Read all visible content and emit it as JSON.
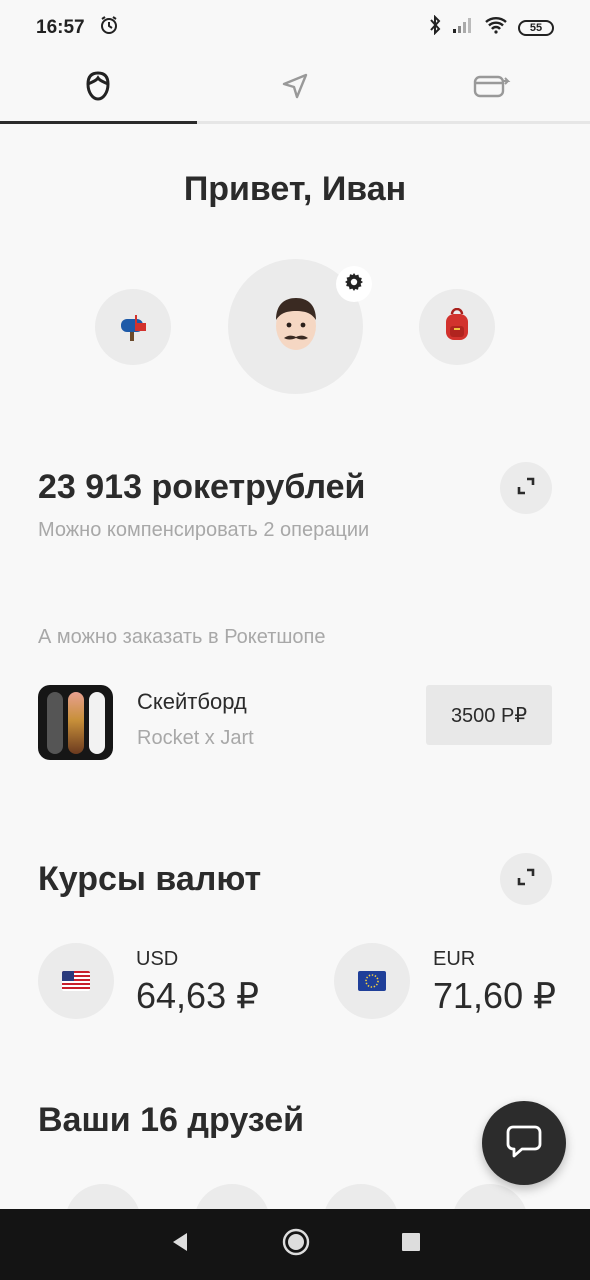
{
  "status_bar": {
    "time": "16:57",
    "battery": "55"
  },
  "tabs": [
    {
      "name": "profile",
      "icon": "face-icon",
      "active": true
    },
    {
      "name": "send",
      "icon": "paper-plane-icon",
      "active": false
    },
    {
      "name": "cards",
      "icon": "card-icon",
      "active": false
    }
  ],
  "greeting": "Привет, Иван",
  "avatars": {
    "left_emoji": "📫",
    "main_emoji": "👨🏻",
    "right_emoji": "🎒"
  },
  "balance": {
    "amount": "23 913 рокетрублей",
    "subtitle": "Можно компенсировать 2 операции"
  },
  "shop": {
    "label": "А можно заказать в Рокетшопе",
    "product_title": "Скейтборд",
    "product_subtitle": "Rocket x Jart",
    "price": "3500 Р₽"
  },
  "rates": {
    "title": "Курсы валют",
    "items": [
      {
        "code": "USD",
        "value": "64,63 ₽",
        "flag": "us-flag-icon"
      },
      {
        "code": "EUR",
        "value": "71,60 ₽",
        "flag": "eu-flag-icon"
      }
    ]
  },
  "friends": {
    "title": "Ваши 16 друзей"
  },
  "colors": {
    "background": "#f8f8f8",
    "text": "#2b2b2b",
    "muted": "#a8a8a8",
    "circle": "#ebebeb",
    "fab": "#2c2c2c",
    "nav": "#141414"
  }
}
